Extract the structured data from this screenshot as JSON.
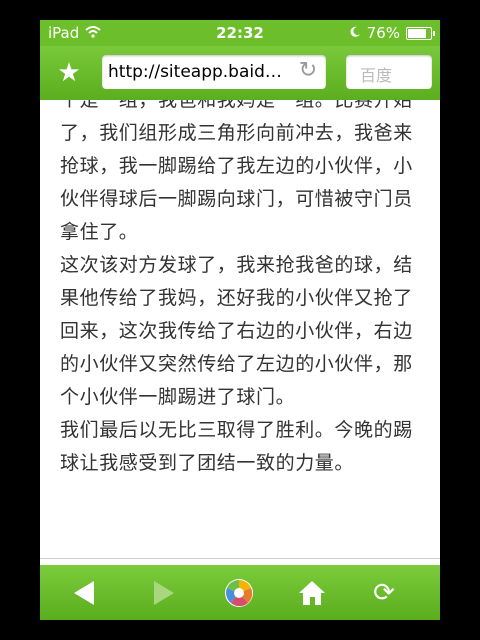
{
  "status_bar": {
    "device": "iPad",
    "time": "22:32",
    "battery": "76%",
    "battery_level": 0.76
  },
  "toolbar": {
    "url": "http://siteapp.baid…",
    "search_placeholder": "百度"
  },
  "content": {
    "paragraphs": [
      "个是一组，我爸和我妈是一组。比赛开始了，我们组形成三角形向前冲去，我爸来抢球，我一脚踢给了我左边的小伙伴，小伙伴得球后一脚踢向球门，可惜被守门员拿住了。",
      "这次该对方发球了，我来抢我爸的球，结果他传给了我妈，还好我的小伙伴又抢了回来，这次我传给了右边的小伙伴，右边的小伙伴又突然传给了左边的小伙伴，那个小伙伴一脚踢进了球门。",
      "我们最后以无比三取得了胜利。今晚的踢球让我感受到了团结一致的力量。"
    ]
  },
  "colors": {
    "accent": "#6cbf2a"
  },
  "icons": [
    "wifi-icon",
    "moon-icon",
    "battery-icon",
    "star-icon",
    "reload-icon",
    "back-icon",
    "forward-icon",
    "color-wheel-icon",
    "home-icon",
    "refresh-icon"
  ]
}
